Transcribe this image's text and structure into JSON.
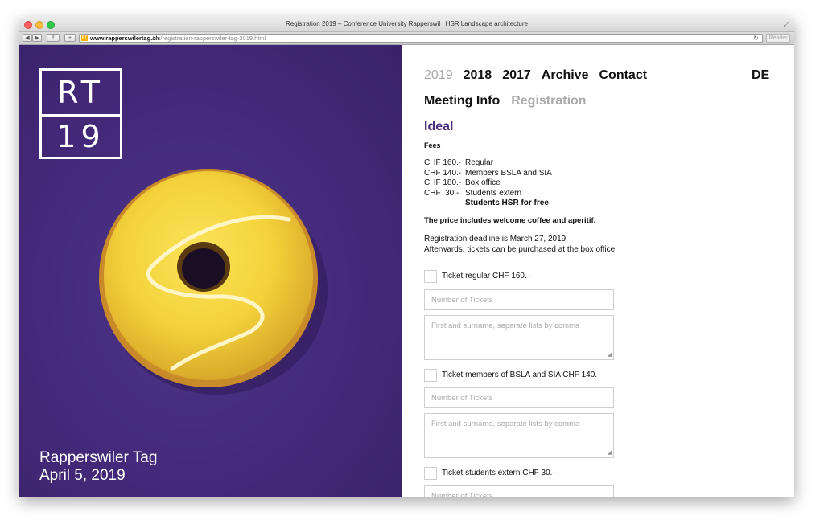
{
  "window": {
    "title": "Registration 2019 – Conference University Rapperswil | HSR Landscape architecture",
    "url_host": "www.rapperswilertag.ch",
    "url_path": "/en/registration-rapperswiler-tag-2019.html",
    "reader_label": "Reader"
  },
  "hero": {
    "logo_top": "RT",
    "logo_bottom": "19",
    "event_name": "Rapperswiler Tag",
    "event_date": "April 5, 2019",
    "background_color": "#44297a",
    "accent_color": "#f4d63a"
  },
  "nav": {
    "items": [
      "2019",
      "2018",
      "2017",
      "Archive",
      "Contact"
    ],
    "active": "2019",
    "lang": "DE"
  },
  "subnav": {
    "meeting_info": "Meeting Info",
    "registration": "Registration"
  },
  "content": {
    "tier": "Ideal",
    "fees_title": "Fees",
    "fees": [
      {
        "amount": "CHF 160.-",
        "desc": "Regular"
      },
      {
        "amount": "CHF 140.-",
        "desc": "Members BSLA and SIA"
      },
      {
        "amount": "CHF 180.-",
        "desc": "Box office"
      },
      {
        "amount": "CHF  30.-",
        "desc": "Students extern"
      },
      {
        "amount": "",
        "desc": "Students HSR for free"
      }
    ],
    "price_note": "The price includes welcome coffee and aperitif.",
    "deadline_line1": "Registration deadline is March 27, 2019.",
    "deadline_line2": "Afterwards, tickets can be purchased at the box office."
  },
  "form": {
    "tickets": [
      {
        "label": "Ticket regular CHF 160.–"
      },
      {
        "label": "Ticket members of BSLA and SIA CHF 140.–"
      },
      {
        "label": "Ticket students extern CHF 30.–"
      }
    ],
    "count_placeholder": "Number of Tickets",
    "names_placeholder": "First and surname, separate lists by comma"
  }
}
